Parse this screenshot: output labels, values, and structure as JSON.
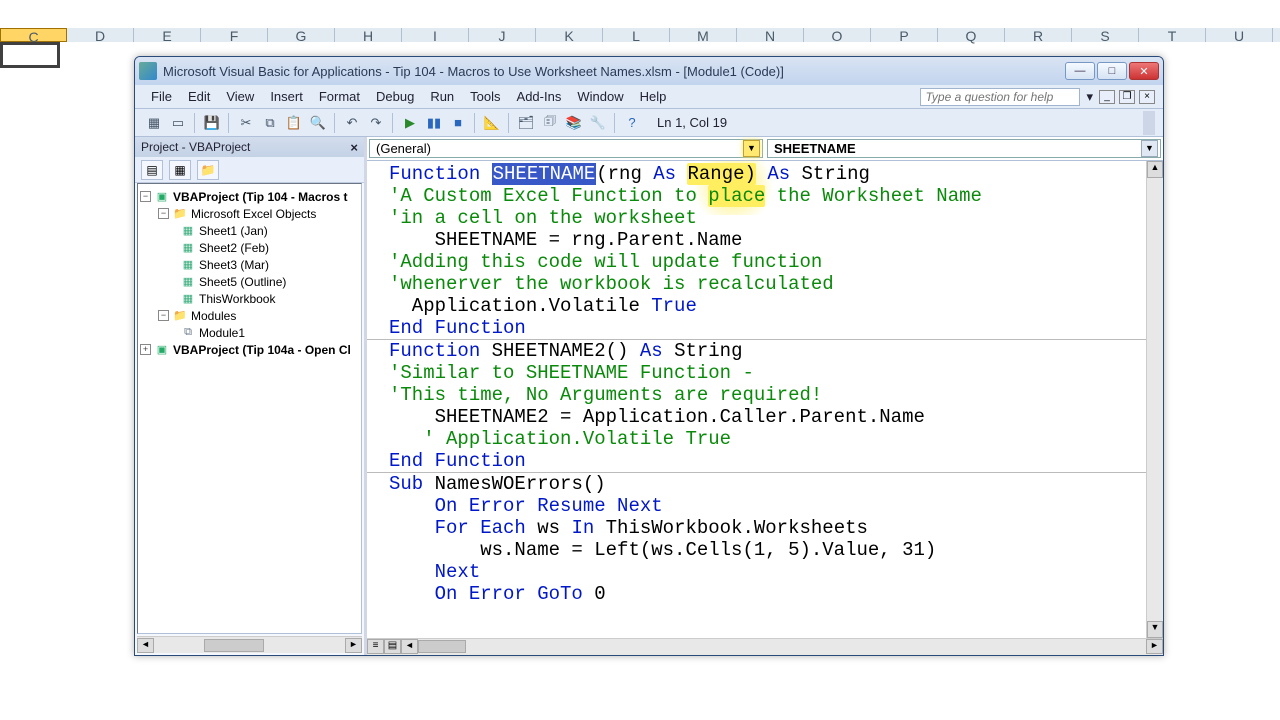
{
  "excel_cols": [
    "C",
    "D",
    "E",
    "F",
    "G",
    "H",
    "I",
    "J",
    "K",
    "L",
    "M",
    "N",
    "O",
    "P",
    "Q",
    "R",
    "S",
    "T",
    "U"
  ],
  "selected_col_index": 0,
  "window": {
    "title": "Microsoft Visual Basic for Applications - Tip 104 - Macros to Use Worksheet Names.xlsm - [Module1 (Code)]"
  },
  "menu": [
    "File",
    "Edit",
    "View",
    "Insert",
    "Format",
    "Debug",
    "Run",
    "Tools",
    "Add-Ins",
    "Window",
    "Help"
  ],
  "help_placeholder": "Type a question for help",
  "cursor_pos": "Ln 1, Col 19",
  "project": {
    "pane_title": "Project - VBAProject",
    "tree": {
      "proj1": "VBAProject (Tip 104 - Macros t",
      "folder_objs": "Microsoft Excel Objects",
      "sheets": [
        "Sheet1 (Jan)",
        "Sheet2 (Feb)",
        "Sheet3 (Mar)",
        "Sheet5 (Outline)",
        "ThisWorkbook"
      ],
      "folder_mods": "Modules",
      "module1": "Module1",
      "proj2": "VBAProject (Tip 104a - Open Cl"
    }
  },
  "combos": {
    "object": "(General)",
    "proc": "SHEETNAME"
  },
  "code": {
    "l1_a": "Function ",
    "l1_fn": "SHEETNAME",
    "l1_b": "(rng ",
    "l1_as1": "As",
    "l1_c": " Range) ",
    "l1_as2": "As",
    "l1_d": " String",
    "l2": "'A Custom Excel Function to place the Worksheet Name",
    "l3": "'in a cell on the worksheet",
    "l4": "    SHEETNAME = rng.Parent.Name",
    "l5": "'Adding this code will update function",
    "l6": "'whenerver the workbook is recalculated",
    "l7a": "  Application.Volatile ",
    "l7b": "True",
    "l8": "End Function",
    "l9a": "Function",
    "l9b": " SHEETNAME2() ",
    "l9c": "As",
    "l9d": " String",
    "l10": "'Similar to SHEETNAME Function -",
    "l11": "'This time, No Arguments are required!",
    "l12": "    SHEETNAME2 = Application.Caller.Parent.Name",
    "l13": "   ' Application.Volatile True",
    "l14": "End Function",
    "l15a": "Sub",
    "l15b": " NamesWOErrors()",
    "l16a": "    On Error Resume Next",
    "l17a": "    For Each",
    "l17b": " ws ",
    "l17c": "In",
    "l17d": " ThisWorkbook.Worksheets",
    "l18": "        ws.Name = Left(ws.Cells(1, 5).Value, 31)",
    "l19": "    Next",
    "l20a": "    On Error GoTo",
    "l20b": " 0"
  }
}
